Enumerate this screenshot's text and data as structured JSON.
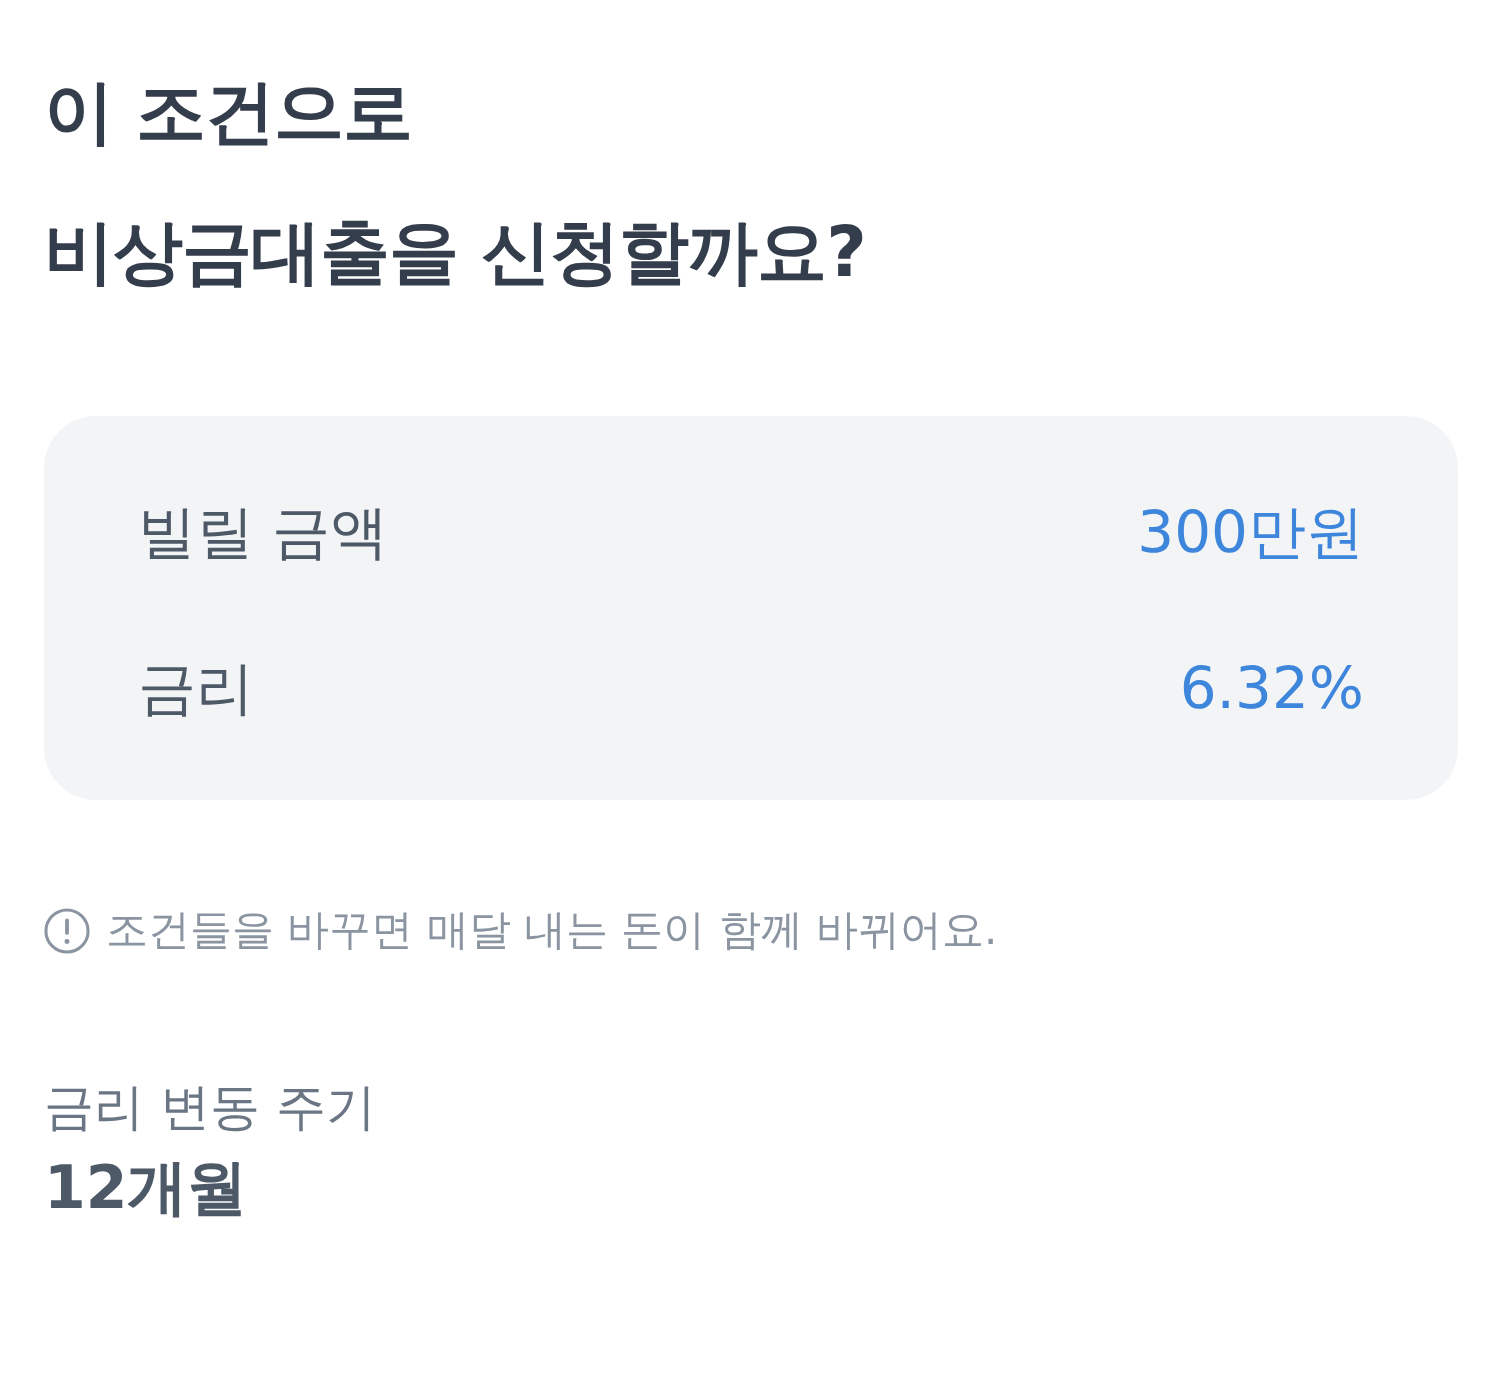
{
  "title": [
    "이 조건으로",
    "비상금대출을 신청할까요?"
  ],
  "summary": [
    {
      "label": "빌릴 금액",
      "value": "300만원"
    },
    {
      "label": "금리",
      "value": "6.32%"
    }
  ],
  "notice": {
    "text": "조건들을 바꾸면 매달 내는 돈이 함께 바뀌어요."
  },
  "detail": {
    "label": "금리 변동 주기",
    "value": "12개월"
  }
}
